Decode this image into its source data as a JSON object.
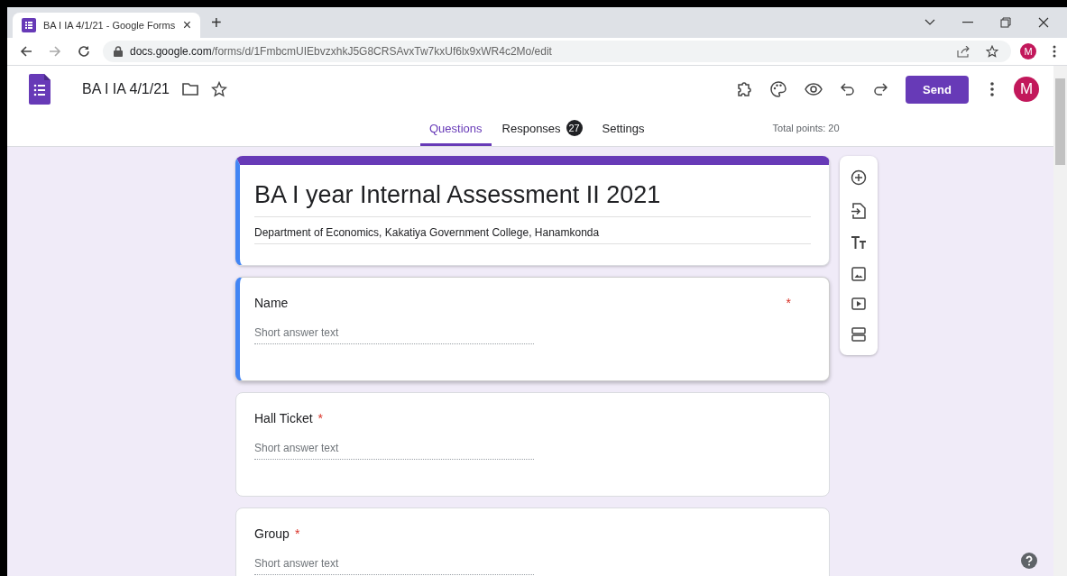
{
  "browser": {
    "tab_title": "BA I IA 4/1/21 - Google Forms",
    "tab_close": "×",
    "new_tab": "+",
    "url_host": "docs.google.com",
    "url_path": "/forms/d/1FmbcmUIEbvzxhkJ5G8CRSAvxTw7kxUf6lx9xWR4c2Mo/edit",
    "profile_initial": "M"
  },
  "app": {
    "doc_title": "BA I IA 4/1/21",
    "send_label": "Send",
    "avatar_initial": "M"
  },
  "tabs": [
    {
      "label": "Questions",
      "selected": true
    },
    {
      "label": "Responses",
      "selected": false,
      "badge": "27"
    },
    {
      "label": "Settings",
      "selected": false
    }
  ],
  "total_points": "Total points: 20",
  "form": {
    "title": "BA I year Internal Assessment II 2021",
    "description": "Department of Economics, Kakatiya Government College, Hanamkonda"
  },
  "questions": [
    {
      "title": "Name",
      "required": true,
      "required_mark": "*",
      "selected": true,
      "placeholder": "Short answer text"
    },
    {
      "title": "Hall Ticket",
      "required": true,
      "required_mark": "*",
      "selected": false,
      "placeholder": "Short answer text"
    },
    {
      "title": "Group",
      "required": true,
      "required_mark": "*",
      "selected": false,
      "placeholder": "Short answer text"
    }
  ]
}
